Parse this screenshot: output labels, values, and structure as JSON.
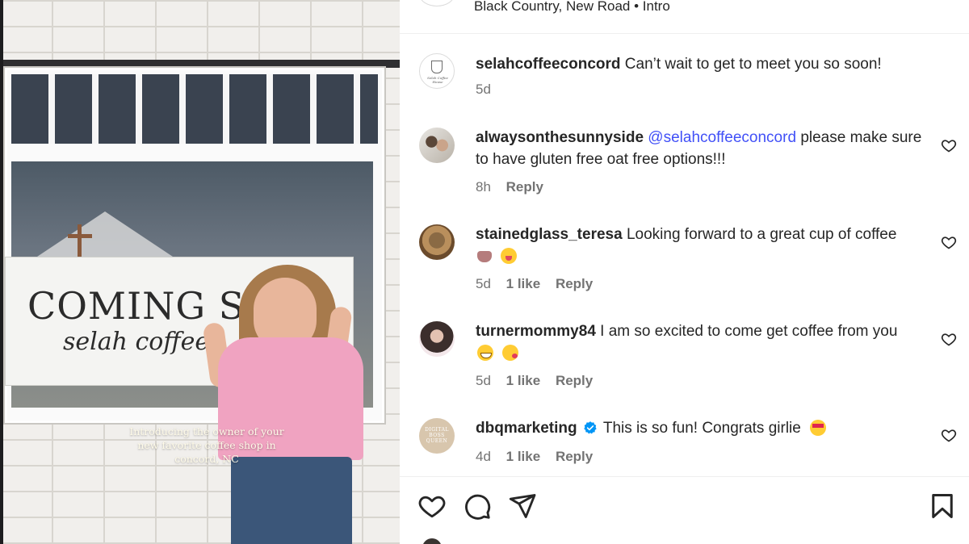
{
  "media": {
    "banner_title": "COMING SOO",
    "banner_subtitle": "selah coffee",
    "caption": "Introducing the owner of your new favorite coffee shop in concord, NC"
  },
  "header": {
    "location": "Black Country, New Road • Intro"
  },
  "comments": [
    {
      "username": "selahcoffeeconcord",
      "text": "Can’t wait to get to meet you so soon!",
      "time": "5d",
      "likes": "",
      "reply": ""
    },
    {
      "username": "alwaysonthesunnyside",
      "mention": "@selahcoffeeconcord",
      "text": "please make sure to have gluten free oat free options!!!",
      "time": "8h",
      "likes": "",
      "reply": "Reply"
    },
    {
      "username": "stainedglass_teresa",
      "text": "Looking forward to a great cup of coffee",
      "emojis": [
        "tea-emoji",
        "zany-face-emoji"
      ],
      "time": "5d",
      "likes": "1 like",
      "reply": "Reply"
    },
    {
      "username": "turnermommy84",
      "text": "I am so excited to come get coffee from you",
      "emojis": [
        "grinning-face-emoji",
        "kissing-heart-emoji"
      ],
      "time": "5d",
      "likes": "1 like",
      "reply": "Reply"
    },
    {
      "username": "dbqmarketing",
      "verified": true,
      "text": "This is so fun! Congrats girlie",
      "emojis": [
        "heart-eyes-emoji"
      ],
      "time": "4d",
      "likes": "1 like",
      "reply": "Reply"
    }
  ],
  "avatar_labels": {
    "selah": "Selah Coffee House",
    "dbq": "DIGITAL BOSS QUEEN"
  },
  "colors": {
    "mention": "#4150f7",
    "verified": "#0095f6",
    "meta": "#737373",
    "text": "#262626"
  }
}
